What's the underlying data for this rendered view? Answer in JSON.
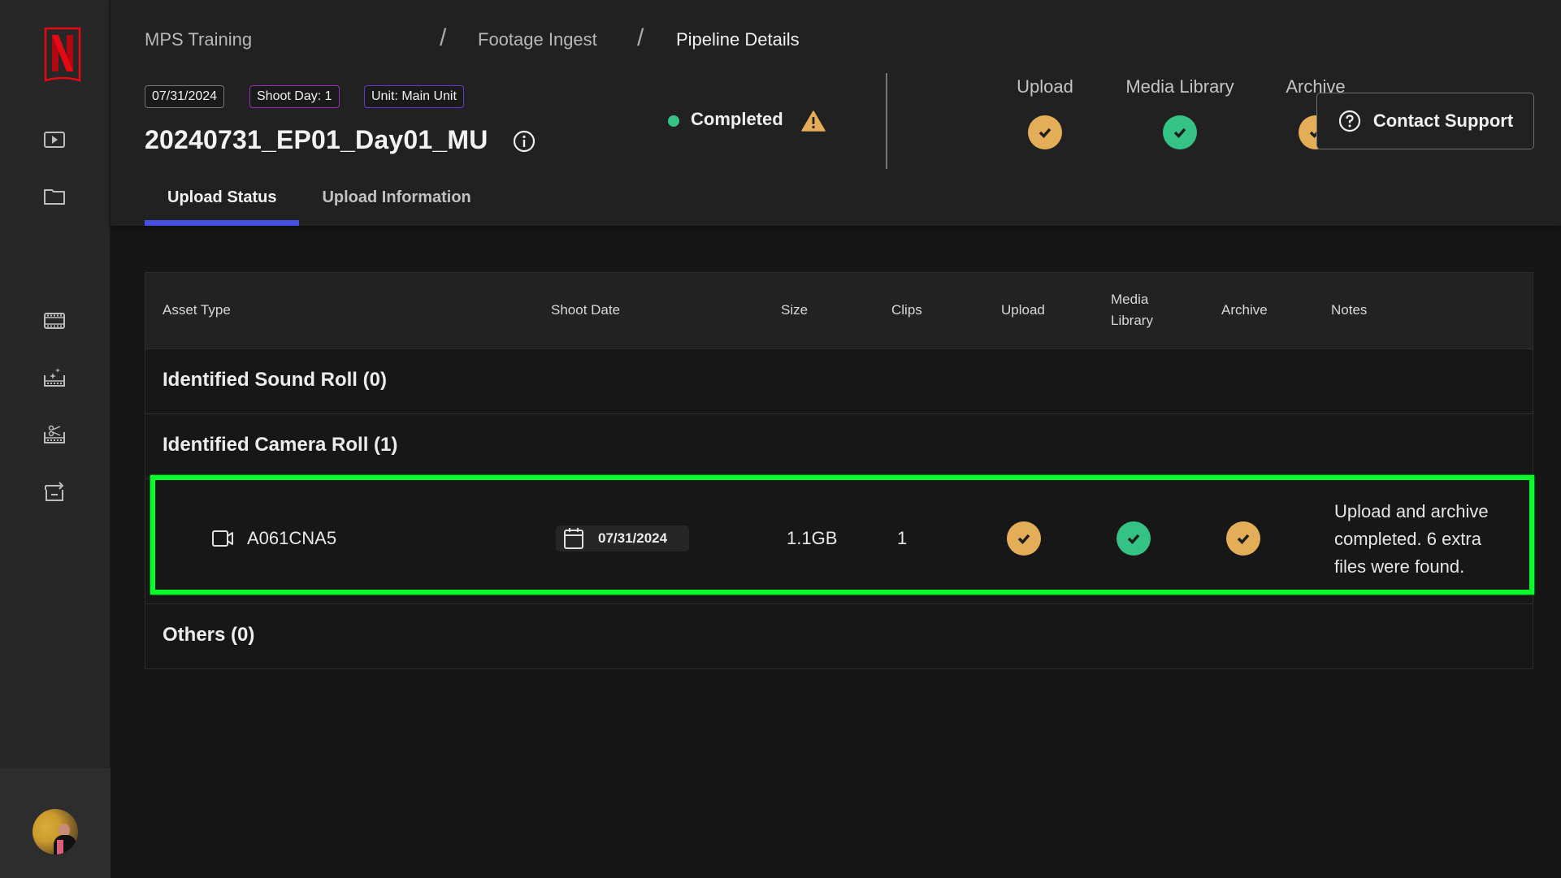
{
  "sidebar": {
    "logo": "netflix-logo",
    "items": [
      {
        "icon": "play-icon",
        "label": "Playback"
      },
      {
        "icon": "folder-icon",
        "label": "Files"
      },
      {
        "icon": "film-strip-icon",
        "label": "Footage"
      },
      {
        "icon": "film-sparkle-icon",
        "label": "Enhance"
      },
      {
        "icon": "film-scissors-icon",
        "label": "Edit"
      },
      {
        "icon": "archive-export-icon",
        "label": "Archive"
      }
    ],
    "user": {
      "avatar": "user-avatar"
    }
  },
  "breadcrumb": {
    "items": [
      "MPS Training",
      "Footage Ingest",
      "Pipeline Details"
    ],
    "separator": "/"
  },
  "tags": {
    "date": "07/31/2024",
    "shoot_day": "Shoot Day: 1",
    "unit": "Unit: Main Unit"
  },
  "pipeline": {
    "title": "20240731_EP01_Day01_MU",
    "status": "Completed",
    "status_color": "#35c285",
    "warning": true
  },
  "stages": [
    {
      "label": "Upload",
      "state": "complete-with-warning",
      "color": "#e4ae58"
    },
    {
      "label": "Media Library",
      "state": "complete",
      "color": "#35c285"
    },
    {
      "label": "Archive",
      "state": "complete-with-warning",
      "color": "#e4ae58"
    }
  ],
  "support_button": {
    "label": "Contact Support"
  },
  "tabs": [
    {
      "label": "Upload Status",
      "active": true
    },
    {
      "label": "Upload Information",
      "active": false
    }
  ],
  "accent_color": "#4650e0",
  "table": {
    "columns": [
      "Asset Type",
      "Shoot Date",
      "Size",
      "Clips",
      "Upload",
      "Media\nLibrary",
      "Archive",
      "Notes"
    ],
    "column_media_library_line1": "Media",
    "column_media_library_line2": "Library",
    "groups": [
      {
        "title": "Identified Sound Roll (0)"
      },
      {
        "title": "Identified Camera Roll (1)"
      },
      {
        "title": "Others (0)"
      }
    ],
    "rows": [
      {
        "asset": "A061CNA5",
        "shoot_date": "07/31/2024",
        "size": "1.1GB",
        "clips": "1",
        "upload": "complete-with-warning",
        "media_library": "complete",
        "archive": "complete-with-warning",
        "notes": "Upload and archive completed. 6 extra files were found."
      }
    ]
  }
}
